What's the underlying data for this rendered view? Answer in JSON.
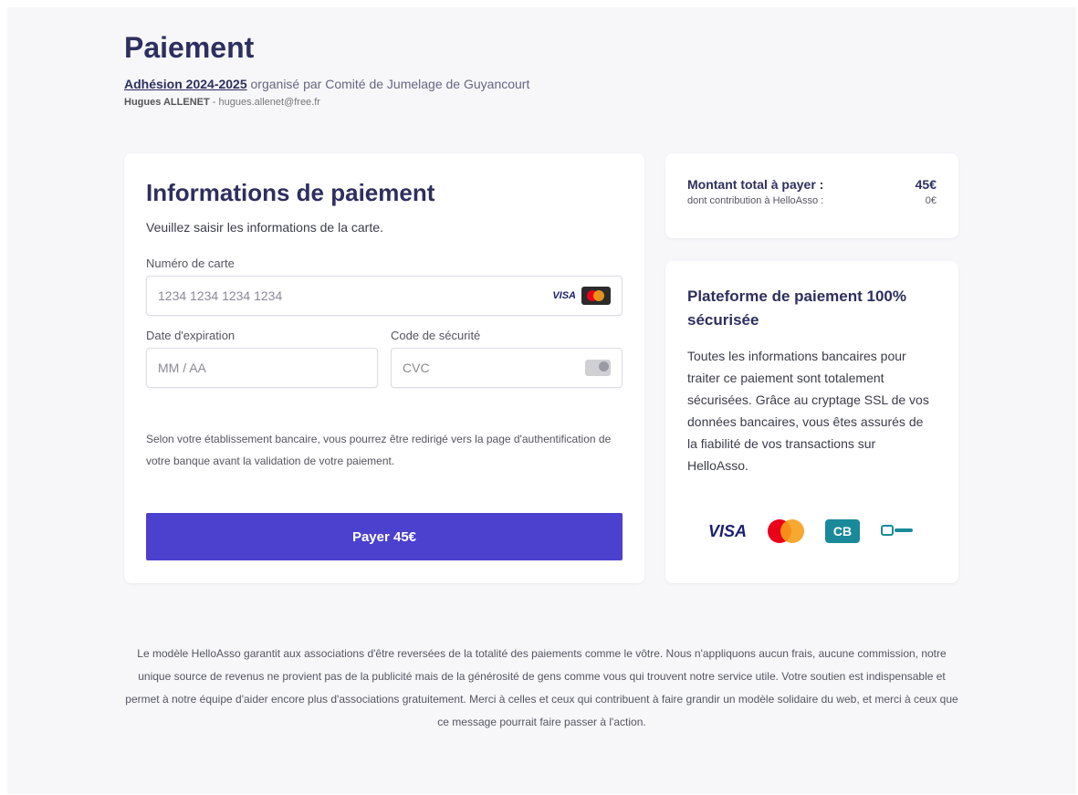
{
  "header": {
    "title": "Paiement",
    "campaign_link": "Adhésion 2024-2025",
    "organized_by": " organisé par Comité de Jumelage de Guyancourt",
    "user_name": "Hugues ALLENET",
    "user_email": " - hugues.allenet@free.fr"
  },
  "payment": {
    "title": "Informations de paiement",
    "subtitle": "Veuillez saisir les informations de la carte.",
    "card_number_label": "Numéro de carte",
    "card_number_placeholder": "1234 1234 1234 1234",
    "card_brand_visa": "VISA",
    "expiry_label": "Date d'expiration",
    "expiry_placeholder": "MM / AA",
    "cvc_label": "Code de sécurité",
    "cvc_placeholder": "CVC",
    "note": "Selon votre établissement bancaire, vous pourrez être redirigé vers la page d'authentification de votre banque avant la validation de votre paiement.",
    "pay_button": "Payer 45€"
  },
  "summary": {
    "total_label": "Montant total à payer :",
    "total_value": "45€",
    "contribution_label": "dont contribution à HelloAsso :",
    "contribution_value": "0€"
  },
  "secure": {
    "title": "Plateforme de paiement 100% sécurisée",
    "text": "Toutes les informations bancaires pour traiter ce paiement sont totalement sécurisées. Grâce au cryptage SSL de vos données bancaires, vous êtes assurés de la fiabilité de vos transactions sur HelloAsso.",
    "logo_visa": "VISA",
    "logo_cb": "CB"
  },
  "footer": {
    "text": "Le modèle HelloAsso garantit aux associations d'être reversées de la totalité des paiements comme le vôtre. Nous n'appliquons aucun frais, aucune commission, notre unique source de revenus ne provient pas de la publicité mais de la générosité de gens comme vous qui trouvent notre service utile. Votre soutien est indispensable et permet à notre équipe d'aider encore plus d'associations gratuitement. Merci à celles et ceux qui contribuent à faire grandir un modèle solidaire du web, et merci à ceux que ce message pourrait faire passer à l'action."
  },
  "colors": {
    "primary": "#4c40cf",
    "heading": "#2e2f5e",
    "background": "#f7f7fa"
  },
  "icons": [
    "visa-icon",
    "mastercard-icon",
    "cvc-card-icon",
    "cb-icon"
  ]
}
